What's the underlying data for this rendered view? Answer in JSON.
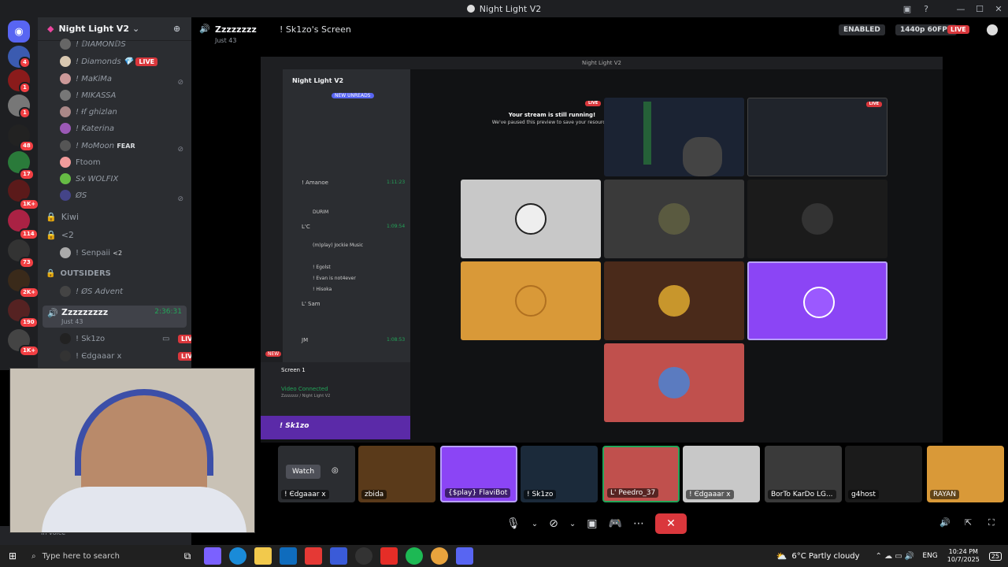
{
  "window": {
    "title": "Night Light V2"
  },
  "server": {
    "name": "Night Light V2"
  },
  "guild_badges": [
    "4",
    "1",
    "1",
    "48",
    "17",
    "1K+",
    "114",
    "73",
    "2K+",
    "190",
    "1K+"
  ],
  "voice_users_top": [
    {
      "name": "! ⅅIAMONⅅS",
      "badge": "💎"
    },
    {
      "name": "! Diamonds",
      "live": "LIVE"
    },
    {
      "name": "! MaKiMa"
    },
    {
      "name": "! MIKASSA"
    },
    {
      "name": "! Ɨf ghizlan"
    },
    {
      "name": "! Katerina"
    },
    {
      "name": "! MoMoon",
      "tag": "FEAR"
    },
    {
      "name": "Ftoom"
    },
    {
      "name": "Sx WOLFIX"
    },
    {
      "name": "ØS"
    }
  ],
  "channels": {
    "kiwi": "Kiwi",
    "lt2": "<2",
    "senpaii": "! Senpaii",
    "senpaii_tag": "<2",
    "category": "OUTSIDERS",
    "advent": "! ØS Advent",
    "active": "Zzzzzzzzz",
    "active_time": "2:36:31",
    "active_sub": "Just 43",
    "sk1zo": "! Sk1zo",
    "edgaaar": "! Єdgaaar x",
    "live": "LIVE"
  },
  "topbar": {
    "channel": "Zzzzzzzz",
    "subtitle": "Just 43",
    "screen_title": "! Sk1zo's Screen",
    "enabled": "ENABLED",
    "quality": "1440p 60FPS",
    "live": "LIVE"
  },
  "stream": {
    "window_title": "Night Light V2",
    "running_title": "Your stream is still running!",
    "running_sub": "We've paused this preview to save your resources.",
    "live": "LIVE",
    "inner_server": "Night Light V2",
    "new_unreads": "NEW UNREADS",
    "inner_rows": [
      {
        "name": "! Amanoe",
        "time": "1:11:23"
      },
      {
        "name": "DURIM"
      },
      {
        "name": "L'C",
        "time": "1:09:54"
      },
      {
        "name": "(m)play) Jockie Music"
      },
      {
        "name": "! Egolst"
      },
      {
        "name": "! Evan is not4ever"
      },
      {
        "name": "! Hisoka"
      },
      {
        "name": "L' Sam"
      },
      {
        "name": "JM",
        "time": "1:08:53"
      }
    ],
    "screen_label": "Screen 1",
    "video_connected": "Video Connected",
    "video_sub": "Zzzzzzzz / Night Light V2",
    "inner_user": "! Sk1zo",
    "new": "NEW"
  },
  "tiles_colors": [
    "#c8c8c8",
    "#3a3a3a",
    "#1b1b1b",
    "#d99938",
    "#4a2a1a",
    "#8b45f5",
    "#c0504d"
  ],
  "strip": {
    "watch": "Watch",
    "users": [
      {
        "name": "! Єdgaaar x"
      },
      {
        "name": "zbida"
      },
      {
        "name": "{$play} FlaviBot"
      },
      {
        "name": "! Sk1zo"
      },
      {
        "name": "L' Peedro_37"
      },
      {
        "name": "! Єdgaaar x"
      },
      {
        "name": "BorTo KarDo LG..."
      },
      {
        "name": "g4host"
      },
      {
        "name": "RAYAN"
      }
    ]
  },
  "userpanel": {
    "status": "In voice"
  },
  "taskbar": {
    "search": "Type here to search",
    "weather": "6°C  Partly cloudy",
    "lang": "ENG",
    "time": "10:24 PM",
    "date": "10/7/2025",
    "notif": "25"
  }
}
